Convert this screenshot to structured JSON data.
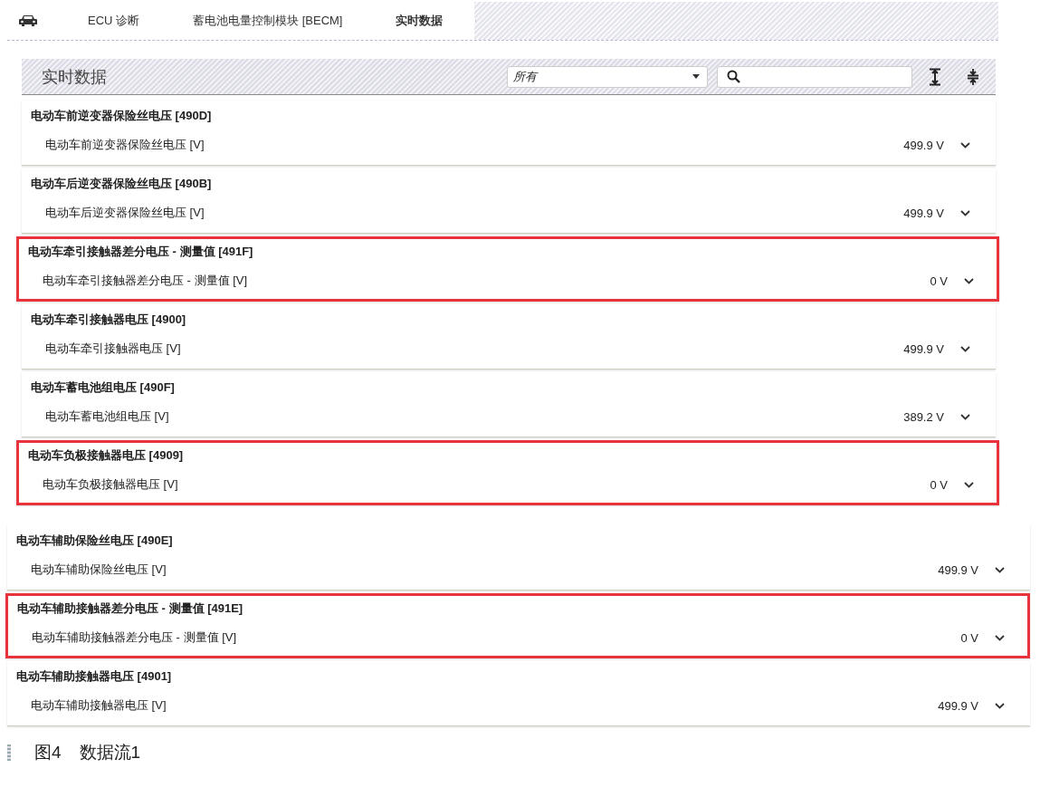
{
  "breadcrumb": [
    {
      "label": "ECU 诊断",
      "selected": false
    },
    {
      "label": "蓄电池电量控制模块 [BECM]",
      "selected": false
    },
    {
      "label": "实时数据",
      "selected": true
    }
  ],
  "panel": {
    "title": "实时数据",
    "filter": {
      "value": "所有"
    }
  },
  "groups": [
    {
      "rows": [
        {
          "title": "电动车前逆变器保险丝电压 [490D]",
          "name": "电动车前逆变器保险丝电压 [V]",
          "value": "499.9 V",
          "highlighted": false
        },
        {
          "title": "电动车后逆变器保险丝电压 [490B]",
          "name": "电动车后逆变器保险丝电压 [V]",
          "value": "499.9 V",
          "highlighted": false
        },
        {
          "title": "电动车牵引接触器差分电压 - 测量值 [491F]",
          "name": "电动车牵引接触器差分电压 - 测量值 [V]",
          "value": "0 V",
          "highlighted": true
        },
        {
          "title": "电动车牵引接触器电压 [4900]",
          "name": "电动车牵引接触器电压 [V]",
          "value": "499.9 V",
          "highlighted": false
        },
        {
          "title": "电动车蓄电池组电压 [490F]",
          "name": "电动车蓄电池组电压 [V]",
          "value": "389.2 V",
          "highlighted": false
        },
        {
          "title": "电动车负极接触器电压 [4909]",
          "name": "电动车负极接触器电压 [V]",
          "value": "0 V",
          "highlighted": true
        }
      ]
    },
    {
      "rows": [
        {
          "title": "电动车辅助保险丝电压 [490E]",
          "name": "电动车辅助保险丝电压 [V]",
          "value": "499.9 V",
          "highlighted": false
        },
        {
          "title": "电动车辅助接触器差分电压 - 测量值 [491E]",
          "name": "电动车辅助接触器差分电压 - 测量值 [V]",
          "value": "0 V",
          "highlighted": true
        },
        {
          "title": "电动车辅助接触器电压 [4901]",
          "name": "电动车辅助接触器电压 [V]",
          "value": "499.9 V",
          "highlighted": false
        }
      ]
    }
  ],
  "caption": {
    "figure": "图4",
    "text": "数据流1"
  }
}
